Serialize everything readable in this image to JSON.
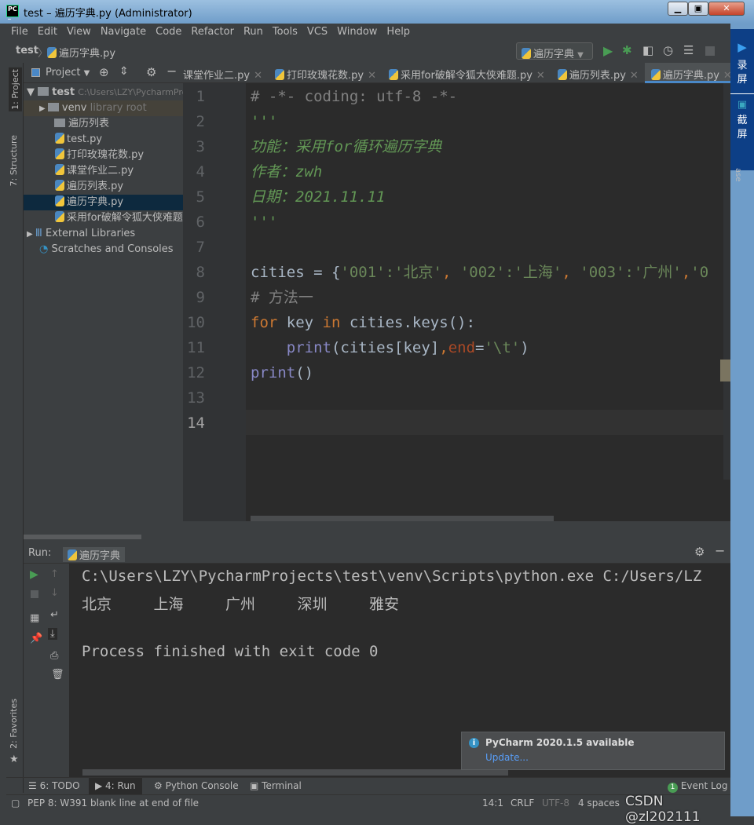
{
  "window": {
    "title": "test – 遍历字典.py (Administrator)",
    "logo": "PC"
  },
  "menu": [
    "File",
    "Edit",
    "View",
    "Navigate",
    "Code",
    "Refactor",
    "Run",
    "Tools",
    "VCS",
    "Window",
    "Help"
  ],
  "breadcrumb": {
    "project": "test",
    "file": "遍历字典.py"
  },
  "run_config": "遍历字典",
  "project_panel": {
    "title": "Project"
  },
  "tabs": [
    {
      "label": "课堂作业二.py"
    },
    {
      "label": "打印玫瑰花数.py"
    },
    {
      "label": "采用for破解令狐大侠难题.py"
    },
    {
      "label": "遍历列表.py"
    },
    {
      "label": "遍历字典.py",
      "active": true
    }
  ],
  "tree": [
    {
      "label": "test",
      "hint": "C:\\Users\\LZY\\PycharmProjects\\test",
      "type": "folder",
      "expanded": true
    },
    {
      "label": "venv",
      "hint": "library root",
      "type": "folder"
    },
    {
      "label": "遍历列表",
      "type": "folder"
    },
    {
      "label": "test.py",
      "type": "py"
    },
    {
      "label": "打印玫瑰花数.py",
      "type": "py"
    },
    {
      "label": "课堂作业二.py",
      "type": "py"
    },
    {
      "label": "遍历列表.py",
      "type": "py"
    },
    {
      "label": "遍历字典.py",
      "type": "py",
      "selected": true
    },
    {
      "label": "采用for破解令狐大侠难题.py",
      "type": "py"
    },
    {
      "label": "External Libraries",
      "type": "lib"
    },
    {
      "label": "Scratches and Consoles",
      "type": "scratch"
    }
  ],
  "side_tools": {
    "project": "1: Project",
    "structure": "7: Structure",
    "favorites": "2: Favorites"
  },
  "code": {
    "line_numbers": [
      "1",
      "2",
      "3",
      "4",
      "5",
      "6",
      "7",
      "8",
      "9",
      "10",
      "11",
      "12",
      "13",
      "14"
    ],
    "l1": "# -*- coding: utf-8 -*-",
    "l2": "'''",
    "l3": "功能：采用for循环遍历字典",
    "l4": "作者：zwh",
    "l5": "日期：2021.11.11",
    "l6": "'''",
    "l8a": "cities = {",
    "l8b": "'001'",
    ":": ":",
    "l8c": "'北京'",
    "l8d": "'002'",
    "l8e": "'上海'",
    "l8f": "'003'",
    "l8g": "'广州'",
    "l8h": "'0",
    "l9": "# 方法一",
    "l10kw1": "for",
    "l10a": " key ",
    "l10kw2": "in",
    "l10b": " cities.keys():",
    "l11fn": "print",
    "l11a": "(cities[key]",
    "l11pa": "end",
    "l11b": "=",
    "l11st": "'\\t'",
    "l11c": ")",
    "l12fn": "print",
    "l12a": "()"
  },
  "run": {
    "label": "Run:",
    "config": "遍历字典",
    "output": [
      "C:\\Users\\LZY\\PycharmProjects\\test\\venv\\Scripts\\python.exe C:/Users/LZ",
      "北京\t上海\t广州\t深圳\t雅安",
      "",
      "Process finished with exit code 0"
    ]
  },
  "notification": {
    "title": "PyCharm 2020.1.5 available",
    "link": "Update..."
  },
  "bottom_tabs": [
    "6: TODO",
    "4: Run",
    "Python Console",
    "Terminal"
  ],
  "event_log": {
    "label": "Event Log",
    "count": "1"
  },
  "status": {
    "message": "PEP 8: W391 blank line at end of file",
    "position": "14:1",
    "line_sep": "CRLF",
    "encoding": "UTF-8",
    "indent": "4 spaces",
    "watermark": "CSDN @zl202111"
  },
  "capture_tool": {
    "record": "录屏",
    "screenshot": "截屏",
    "partial": "ase"
  },
  "colors": {
    "keyword": "#cc7832",
    "string": "#6a8759",
    "docstring": "#629755",
    "builtin": "#8888c6",
    "param": "#aa4926",
    "link": "#589df6",
    "accent": "#4a88c7"
  }
}
